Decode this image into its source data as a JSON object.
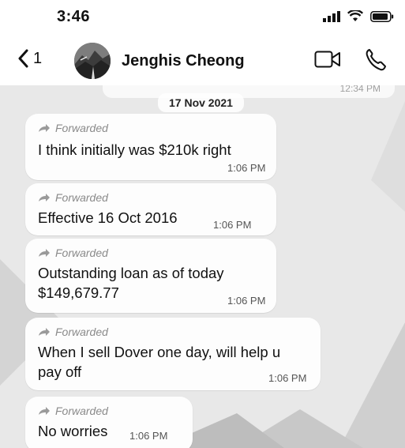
{
  "status_bar": {
    "time": "3:46"
  },
  "header": {
    "back_count": "1",
    "contact_name": "Jenghis Cheong"
  },
  "chat": {
    "previous_message_time": "12:34 PM",
    "date_separator": "17 Nov 2021",
    "messages": [
      {
        "forwarded_label": "Forwarded",
        "text": "I think initially was $210k right",
        "time": "1:06 PM"
      },
      {
        "forwarded_label": "Forwarded",
        "text": "Effective 16 Oct 2016",
        "time": "1:06 PM"
      },
      {
        "forwarded_label": "Forwarded",
        "line1": "Outstanding loan as of today",
        "line2": "$149,679.77",
        "time": "1:06 PM"
      },
      {
        "forwarded_label": "Forwarded",
        "line1": "When I sell Dover one day, will help u",
        "line2": "pay off",
        "time": "1:06 PM"
      },
      {
        "forwarded_label": "Forwarded",
        "text": "No worries",
        "time": "1:06 PM"
      }
    ]
  },
  "icons": [
    "signal-icon",
    "wifi-icon",
    "battery-icon",
    "chevron-left-icon",
    "video-icon",
    "phone-icon",
    "forward-icon"
  ]
}
